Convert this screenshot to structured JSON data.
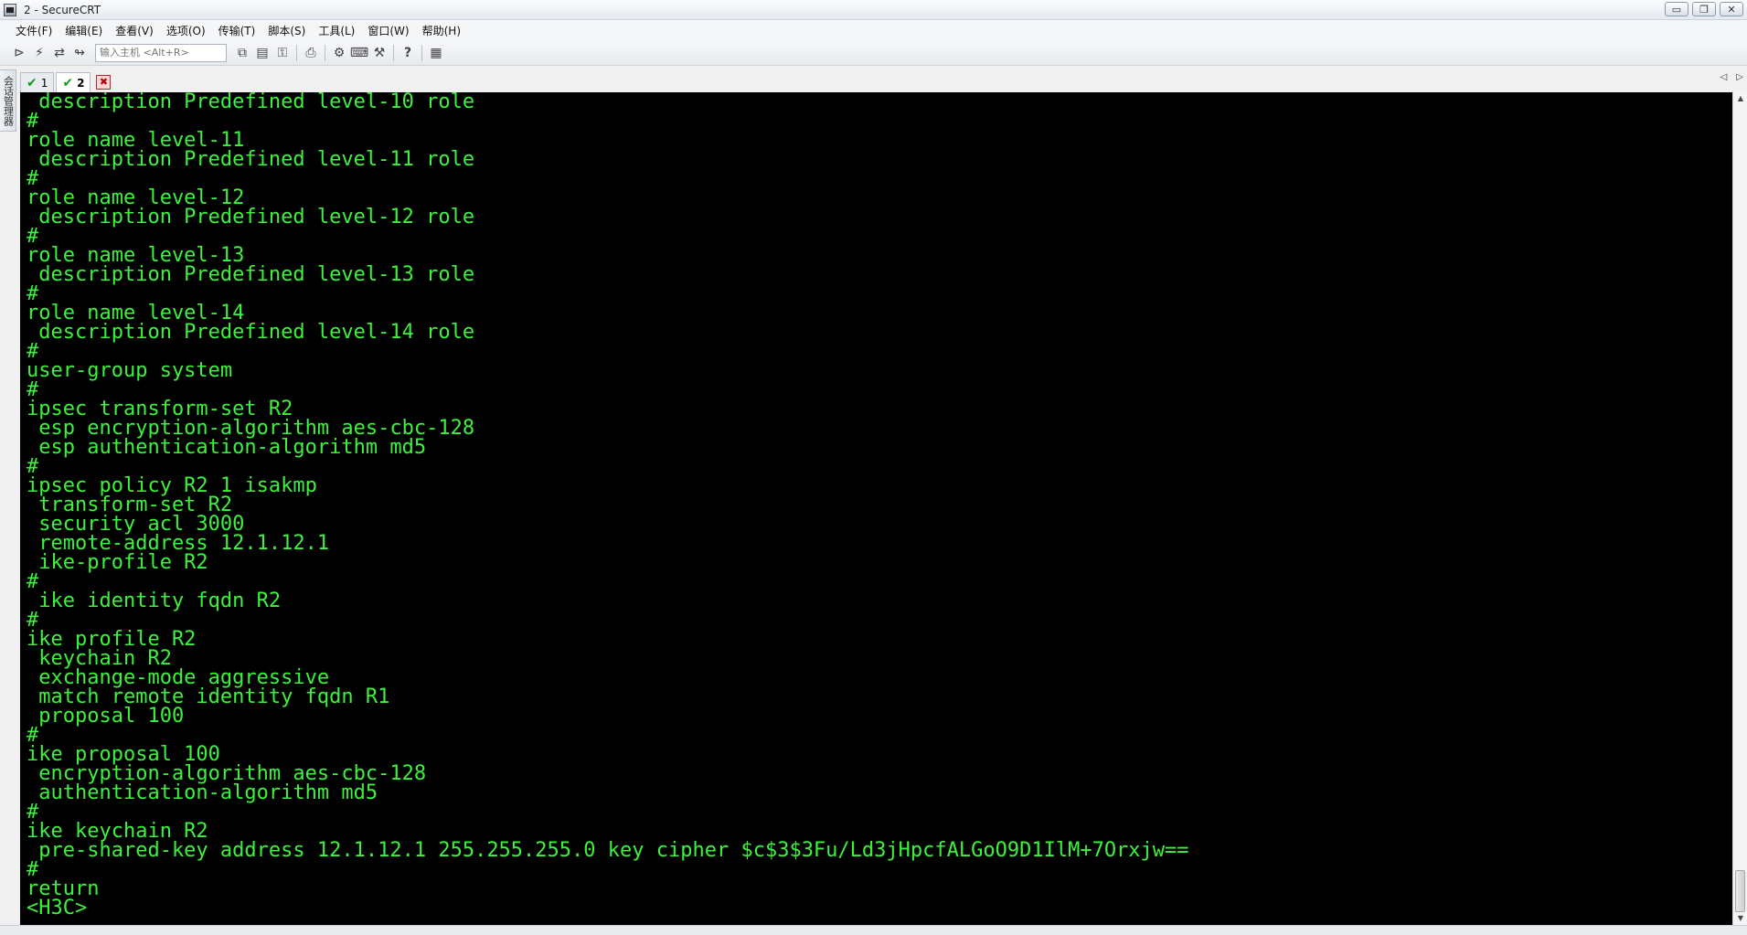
{
  "window": {
    "title": "2 - SecureCRT",
    "minimize": "▭",
    "restore": "❐",
    "close": "✕"
  },
  "menu": [
    "文件(F)",
    "编辑(E)",
    "查看(V)",
    "选项(O)",
    "传输(T)",
    "脚本(S)",
    "工具(L)",
    "窗口(W)",
    "帮助(H)"
  ],
  "toolbar": {
    "host_placeholder": "输入主机 <Alt+R>",
    "icons_left": [
      "connect-icon",
      "quick-connect-icon",
      "reconnect-icon",
      "disconnect-icon"
    ],
    "icons_right": [
      "copy-icon",
      "paste-icon",
      "find-icon",
      "print-icon",
      "settings-icon",
      "keymap-icon",
      "sftp-icon",
      "help-icon",
      "map-icon"
    ]
  },
  "session_manager_label": "会话管理器",
  "tabs": [
    {
      "label": "1",
      "active": false
    },
    {
      "label": "2",
      "active": true
    }
  ],
  "tab_scroll": {
    "left": "◁",
    "right": "▷"
  },
  "terminal": {
    "colors": {
      "bg": "#000000",
      "fg": "#3cf23c"
    },
    "lines": [
      " description Predefined level-10 role",
      "#",
      "role name level-11",
      " description Predefined level-11 role",
      "#",
      "role name level-12",
      " description Predefined level-12 role",
      "#",
      "role name level-13",
      " description Predefined level-13 role",
      "#",
      "role name level-14",
      " description Predefined level-14 role",
      "#",
      "user-group system",
      "#",
      "ipsec transform-set R2",
      " esp encryption-algorithm aes-cbc-128",
      " esp authentication-algorithm md5",
      "#",
      "ipsec policy R2 1 isakmp",
      " transform-set R2",
      " security acl 3000",
      " remote-address 12.1.12.1",
      " ike-profile R2",
      "#",
      " ike identity fqdn R2",
      "#",
      "ike profile R2",
      " keychain R2",
      " exchange-mode aggressive",
      " match remote identity fqdn R1",
      " proposal 100",
      "#",
      "ike proposal 100",
      " encryption-algorithm aes-cbc-128",
      " authentication-algorithm md5",
      "#",
      "ike keychain R2",
      " pre-shared-key address 12.1.12.1 255.255.255.0 key cipher $c$3$3Fu/Ld3jHpcfALGoO9D1IlM+7Orxjw==",
      "#",
      "return",
      "<H3C>"
    ]
  }
}
